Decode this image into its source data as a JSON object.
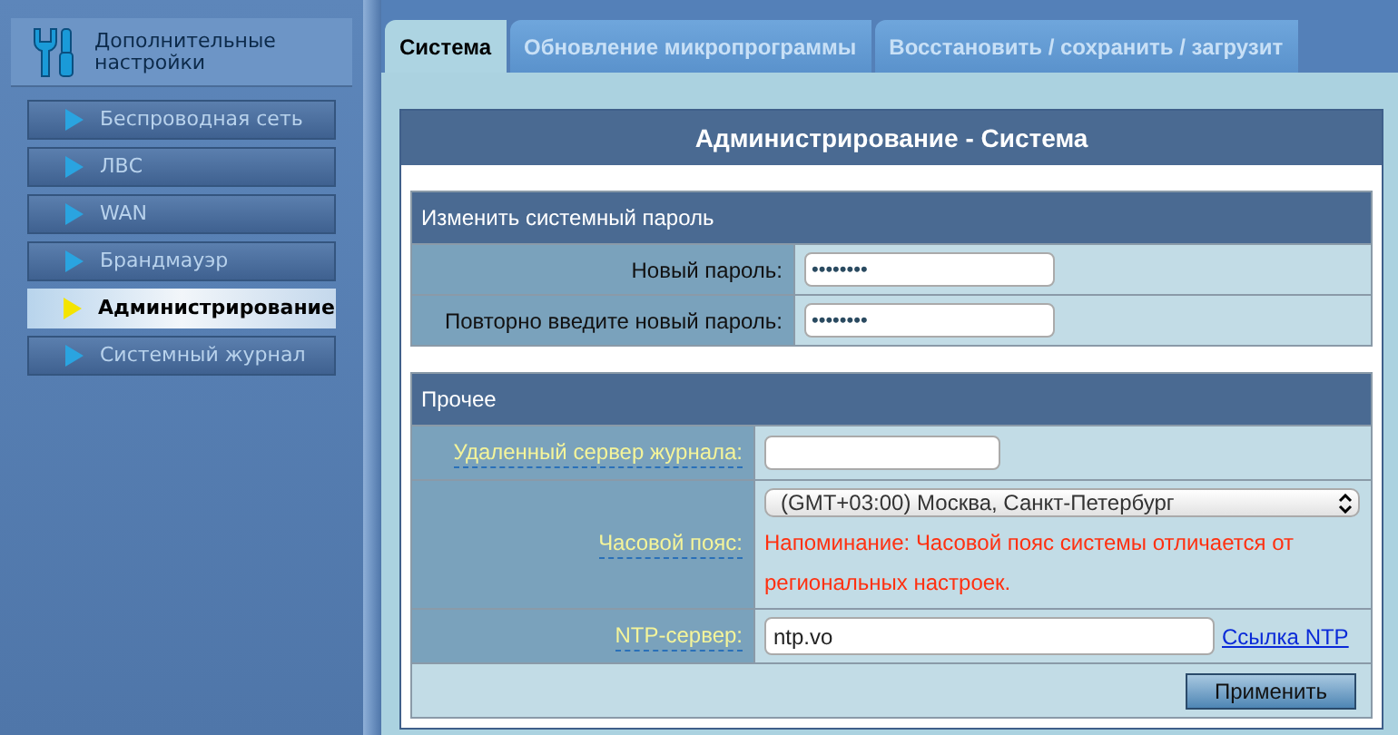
{
  "sidebar": {
    "title": "Дополнительные настройки",
    "items": [
      {
        "label": "Беспроводная сеть",
        "selected": false
      },
      {
        "label": "ЛВС",
        "selected": false
      },
      {
        "label": "WAN",
        "selected": false
      },
      {
        "label": "Брандмауэр",
        "selected": false
      },
      {
        "label": "Администрирование",
        "selected": true
      },
      {
        "label": "Системный журнал",
        "selected": false
      }
    ]
  },
  "tabs": [
    {
      "label": "Система",
      "selected": true
    },
    {
      "label": "Обновление микропрограммы",
      "selected": false
    },
    {
      "label": "Восстановить / сохранить / загрузит",
      "selected": false
    }
  ],
  "panel": {
    "title": "Администрирование - Система",
    "password_section": {
      "title": "Изменить системный пароль",
      "rows": [
        {
          "label": "Новый пароль:",
          "value": "••••••••"
        },
        {
          "label": "Повторно введите новый пароль:",
          "value": "••••••••"
        }
      ]
    },
    "other_section": {
      "title": "Прочее",
      "log_server": {
        "label": "Удаленный сервер журнала:"
      },
      "timezone": {
        "label": "Часовой пояс:",
        "value": "(GMT+03:00) Москва, Санкт-Петербург",
        "warning": "Напоминание: Часовой пояс системы отличается от региональных настроек."
      },
      "ntp": {
        "label": "NTP-сервер:",
        "value": "ntp.vo",
        "link": "Ссылка NTP"
      }
    },
    "apply_button": "Применить"
  }
}
